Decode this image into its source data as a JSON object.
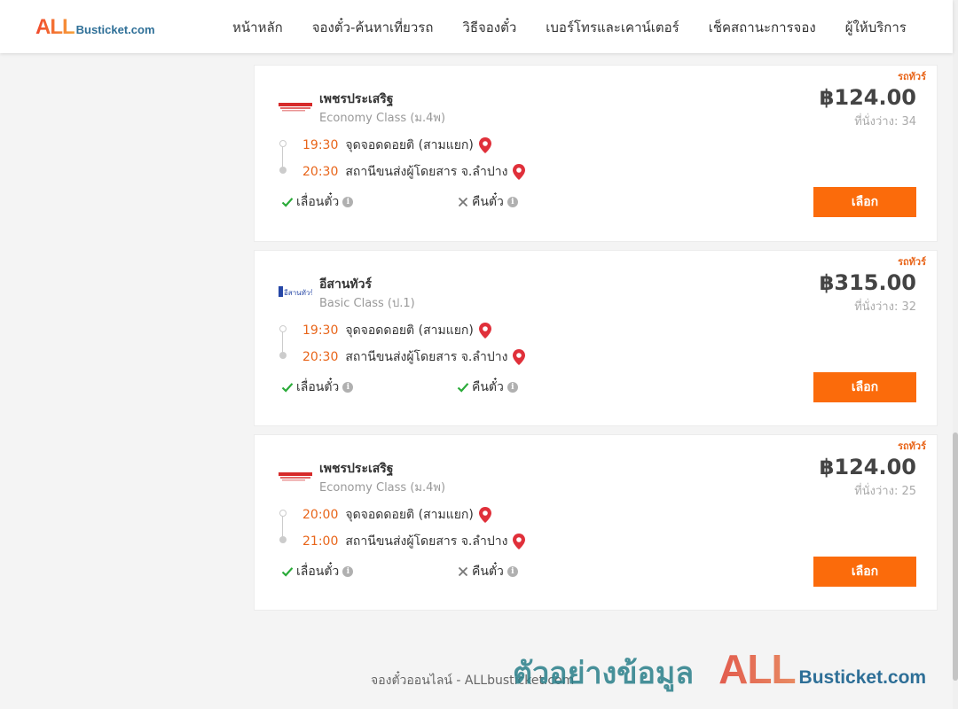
{
  "brand": {
    "logo_big": "ALL",
    "logo_small": "Busticket.com"
  },
  "nav": [
    "หน้าหลัก",
    "จองตั๋ว-ค้นหาเที่ยวรถ",
    "วิธีจองตั๋ว",
    "เบอร์โทรและเคาน์เตอร์",
    "เช็คสถานะการจอง",
    "ผู้ให้บริการ"
  ],
  "trips": [
    {
      "tag": "รถทัวร์",
      "operator": "เพชรประเสริฐ",
      "logo_icon": "phetprasert-logo",
      "class": "Economy Class (ม.4พ)",
      "price": "฿124.00",
      "seats": "ที่นั่งว่าง: 34",
      "depart_time": "19:30",
      "depart_place": "จุดจอดดอยติ (สามแยก)",
      "arrive_time": "20:30",
      "arrive_place": "สถานีขนส่งผู้โดยสาร จ.ลำปาง",
      "reschedule_label": "เลื่อนตั๋ว",
      "reschedule_ok": true,
      "refund_label": "คืนตั๋ว",
      "refund_ok": false,
      "select_label": "เลือก"
    },
    {
      "tag": "รถทัวร์",
      "operator": "อีสานทัวร์",
      "logo_icon": "isan-tour-logo",
      "class": "Basic Class (ป.1)",
      "price": "฿315.00",
      "seats": "ที่นั่งว่าง: 32",
      "depart_time": "19:30",
      "depart_place": "จุดจอดดอยติ (สามแยก)",
      "arrive_time": "20:30",
      "arrive_place": "สถานีขนส่งผู้โดยสาร จ.ลำปาง",
      "reschedule_label": "เลื่อนตั๋ว",
      "reschedule_ok": true,
      "refund_label": "คืนตั๋ว",
      "refund_ok": true,
      "select_label": "เลือก"
    },
    {
      "tag": "รถทัวร์",
      "operator": "เพชรประเสริฐ",
      "logo_icon": "phetprasert-logo",
      "class": "Economy Class (ม.4พ)",
      "price": "฿124.00",
      "seats": "ที่นั่งว่าง: 25",
      "depart_time": "20:00",
      "depart_place": "จุดจอดดอยติ (สามแยก)",
      "arrive_time": "21:00",
      "arrive_place": "สถานีขนส่งผู้โดยสาร จ.ลำปาง",
      "reschedule_label": "เลื่อนตั๋ว",
      "reschedule_ok": true,
      "refund_label": "คืนตั๋ว",
      "refund_ok": false,
      "select_label": "เลือก"
    }
  ],
  "footer": {
    "text": "จองตั๋วออนไลน์ - ALLbusticket.com"
  },
  "watermark": {
    "thai": "ตัวอย่างข้อมูล",
    "all": "ALL",
    "busticket": "Busticket.com"
  },
  "colors": {
    "accent": "#fb6b0b",
    "time": "#e8651a",
    "check": "#2bab3a",
    "cross": "#777777",
    "pin": "#e0303a"
  }
}
